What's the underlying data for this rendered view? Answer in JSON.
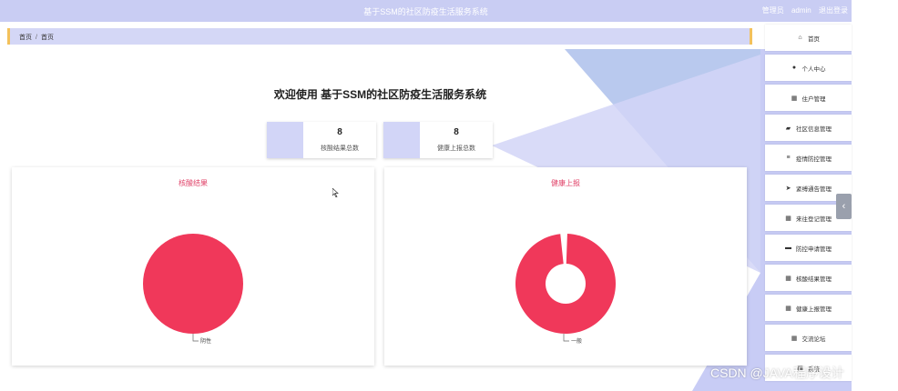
{
  "header": {
    "title": "基于SSM的社区防疫生活服务系统",
    "role": "管理员",
    "username": "admin",
    "logout_label": "退出登录"
  },
  "breadcrumb": {
    "home": "首页",
    "separator": "/",
    "current": "首页"
  },
  "welcome": {
    "text": "欢迎使用 基于SSM的社区防疫生活服务系统"
  },
  "stats": [
    {
      "value": "8",
      "label": "核酸结果总数"
    },
    {
      "value": "8",
      "label": "健康上报总数"
    }
  ],
  "chart_data": [
    {
      "type": "pie",
      "title": "核酸结果",
      "slices": [
        {
          "label": "阴性",
          "value": 8
        }
      ],
      "colors": [
        "#f0385a"
      ]
    },
    {
      "type": "pie",
      "variant": "donut",
      "title": "健康上报",
      "slices": [
        {
          "label": "一般",
          "value": 8
        }
      ],
      "colors": [
        "#f0385a"
      ]
    }
  ],
  "sidebar": {
    "items": [
      {
        "label": "首页",
        "icon": "home-icon"
      },
      {
        "label": "个人中心",
        "icon": "user-icon"
      },
      {
        "label": "住户管理",
        "icon": "grid-icon"
      },
      {
        "label": "社区信息管理",
        "icon": "wallet-icon"
      },
      {
        "label": "疫情防控管理",
        "icon": "list-icon"
      },
      {
        "label": "紧缚通告管理",
        "icon": "send-icon"
      },
      {
        "label": "来往登记管理",
        "icon": "grid-icon"
      },
      {
        "label": "防控申请管理",
        "icon": "chat-icon"
      },
      {
        "label": "核酸结果管理",
        "icon": "grid-icon"
      },
      {
        "label": "健康上报管理",
        "icon": "grid-icon"
      },
      {
        "label": "交流论坛",
        "icon": "grid-icon"
      },
      {
        "label": "系统",
        "icon": "grid-icon"
      }
    ]
  },
  "colors": {
    "accent": "#c9cdf3",
    "pie": "#f0385a",
    "title": "#e0446a"
  },
  "watermark": "CSDN @JAVA程序设计"
}
